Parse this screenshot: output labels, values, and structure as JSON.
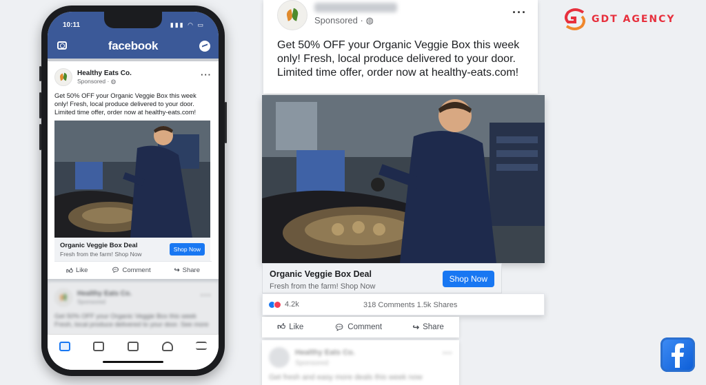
{
  "phone": {
    "status_time": "10:11",
    "app_title": "facebook",
    "post": {
      "advertiser": "Healthy Eats Co.",
      "sponsored": "Sponsored ·",
      "text": "Get 50% OFF your Organic Veggie Box this week only! Fresh, local produce delivered to your door. Limited time offer, order now at healthy-eats.com!",
      "cta_title": "Organic Veggie Box Deal",
      "cta_subtitle": "Fresh from the farm! Shop Now",
      "cta_button": "Shop Now",
      "actions": [
        "Like",
        "Comment",
        "Share"
      ]
    },
    "next_post": {
      "advertiser": "Healthy Eats Co.",
      "sponsored": "Sponsored",
      "text": "Get 50% OFF your Organic Veggie Box this week Fresh, local produce delivered to your door. See more"
    },
    "tabs": [
      "feed-icon",
      "video-icon",
      "marketplace-icon",
      "bell-icon",
      "menu-icon"
    ]
  },
  "zoom": {
    "sponsored": "Sponsored ·",
    "text": "Get 50% OFF your Organic Veggie Box this week only! Fresh, local produce delivered to your door. Limited time offer, order now at healthy-eats.com!",
    "cta_title": "Organic Veggie Box Deal",
    "cta_subtitle": "Fresh from the farm! Shop Now",
    "cta_button": "Shop Now",
    "reactions": "4.2k",
    "comments_shares": "318 Comments  1.5k Shares",
    "actions": [
      "Like",
      "Comment",
      "Share"
    ],
    "next_name": "Healthy Eats Co.",
    "next_sponsored": "Sponsored",
    "next_text": "Get fresh and easy more deals this week now"
  },
  "brand": {
    "agency": "GDT AGENCY",
    "accent": "#e7303d",
    "fb_blue": "#1877f2",
    "fb_nav": "#3b5998"
  }
}
